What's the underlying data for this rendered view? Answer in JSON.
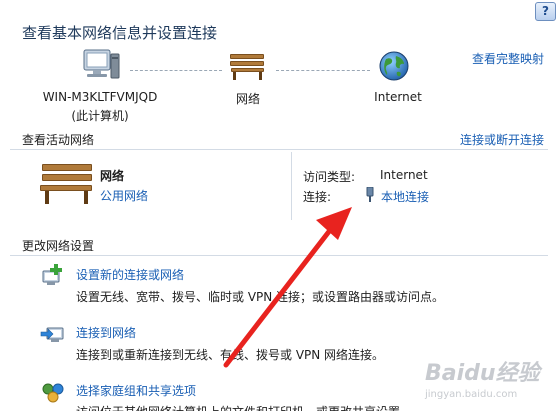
{
  "window": {
    "help_label": "?"
  },
  "header": {
    "title": "查看基本网络信息并设置连接",
    "full_map_link": "查看完整映射"
  },
  "network_map": {
    "computer_name": "WIN-M3KLTFVMJQD",
    "computer_sub": "(此计算机)",
    "network_label": "网络",
    "internet_label": "Internet"
  },
  "active_networks": {
    "heading": "查看活动网络",
    "connect_disconnect_link": "连接或断开连接",
    "network_name": "网络",
    "network_type": "公用网络",
    "access_type_label": "访问类型:",
    "access_type_value": "Internet",
    "connection_label": "连接:",
    "connection_value": "本地连接"
  },
  "change_settings": {
    "heading": "更改网络设置",
    "tasks": [
      {
        "link": "设置新的连接或网络",
        "desc": "设置无线、宽带、拨号、临时或 VPN 连接；或设置路由器或访问点。"
      },
      {
        "link": "连接到网络",
        "desc": "连接到或重新连接到无线、有线、拨号或 VPN 网络连接。"
      },
      {
        "link": "选择家庭组和共享选项",
        "desc": "访问位于其他网络计算机上的文件和打印机，或更改共享设置。"
      }
    ]
  },
  "watermark": {
    "text": "Baidu经验",
    "sub": "jingyan.baidu.com"
  },
  "colors": {
    "link": "#1a5fb4",
    "title": "#1e395b",
    "arrow": "#e8231f"
  }
}
